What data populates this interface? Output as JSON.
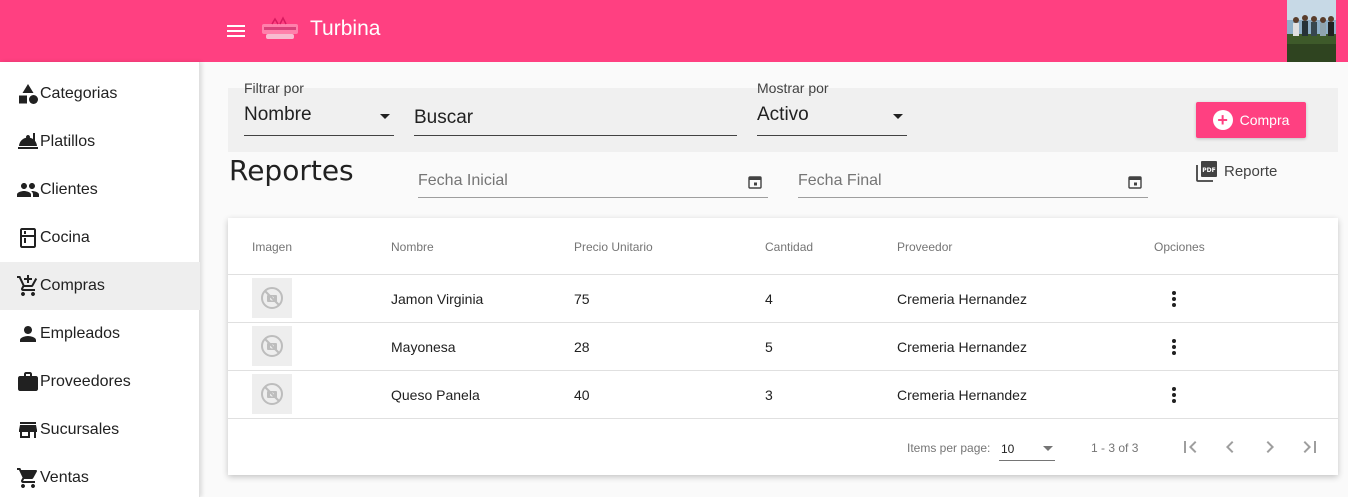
{
  "app": {
    "title": "Turbina",
    "brand_color": "#ff4081"
  },
  "sidebar": {
    "items": [
      {
        "label": "Categorias",
        "icon": "category-icon",
        "active": false
      },
      {
        "label": "Platillos",
        "icon": "room-service-icon",
        "active": false
      },
      {
        "label": "Clientes",
        "icon": "people-icon",
        "active": false
      },
      {
        "label": "Cocina",
        "icon": "kitchen-icon",
        "active": false
      },
      {
        "label": "Compras",
        "icon": "add-shopping-cart-icon",
        "active": true
      },
      {
        "label": "Empleados",
        "icon": "person-icon",
        "active": false
      },
      {
        "label": "Proveedores",
        "icon": "work-icon",
        "active": false
      },
      {
        "label": "Sucursales",
        "icon": "store-icon",
        "active": false
      },
      {
        "label": "Ventas",
        "icon": "shopping-cart-icon",
        "active": false
      }
    ]
  },
  "filters": {
    "filter_by_label": "Filtrar por",
    "filter_by_value": "Nombre",
    "search_placeholder": "Buscar",
    "show_by_label": "Mostrar por",
    "show_by_value": "Activo",
    "add_button_label": "Compra"
  },
  "reports": {
    "title": "Reportes",
    "start_date_placeholder": "Fecha Inicial",
    "end_date_placeholder": "Fecha Final",
    "report_link_label": "Reporte"
  },
  "table": {
    "headers": [
      "Imagen",
      "Nombre",
      "Precio Unitario",
      "Cantidad",
      "Proveedor",
      "Opciones"
    ],
    "rows": [
      {
        "nombre": "Jamon Virginia",
        "precio": "75",
        "cantidad": "4",
        "proveedor": "Cremeria Hernandez"
      },
      {
        "nombre": "Mayonesa",
        "precio": "28",
        "cantidad": "5",
        "proveedor": "Cremeria Hernandez"
      },
      {
        "nombre": "Queso Panela",
        "precio": "40",
        "cantidad": "3",
        "proveedor": "Cremeria Hernandez"
      }
    ]
  },
  "paginator": {
    "items_per_page_label": "Items per page:",
    "page_size": "10",
    "range_label": "1 - 3 of 3"
  }
}
